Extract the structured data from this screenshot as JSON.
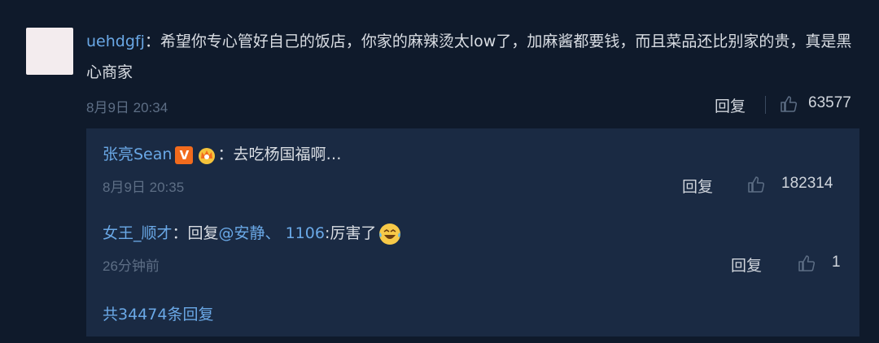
{
  "main_comment": {
    "username": "uehdgfj",
    "colon": "：",
    "text": "希望你专心管好自己的饭店，你家的麻辣烫太low了，加麻酱都要钱，而且菜品还比别家的贵，真是黑心商家",
    "time": "8月9日 20:34",
    "reply_label": "回复",
    "likes": "63577"
  },
  "replies": [
    {
      "username": "张亮Sean",
      "badge": "V",
      "colon": "：",
      "text": "去吃杨国福啊…",
      "time": "8月9日 20:35",
      "reply_label": "回复",
      "likes": "182314"
    },
    {
      "username": "女王_顺才",
      "colon": "：",
      "reply_prefix": "回复",
      "mention": "@安静、 1106",
      "text": ":厉害了",
      "time": "26分钟前",
      "reply_label": "回复",
      "likes": "1"
    }
  ],
  "total_replies": "共34474条回复",
  "colors": {
    "background": "#0f1a2b",
    "panel": "#1a2a43",
    "link": "#6aa8e6",
    "muted": "#5d6e85"
  },
  "icons": {
    "like": "thumbs-up-icon",
    "verified": "v-badge-icon",
    "crown": "crown-icon",
    "emoji": "laughing-tears-emoji"
  }
}
